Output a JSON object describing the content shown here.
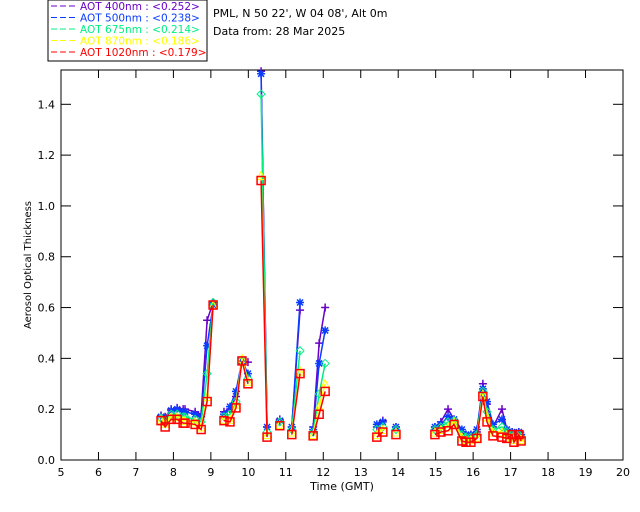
{
  "header": {
    "site": "PML, N 50 22', W 04 08', Alt 0m",
    "date": "Data from: 28 Mar 2025"
  },
  "chart_data": {
    "type": "line",
    "title": "",
    "xlabel": "Time (GMT)",
    "ylabel": "Aerosol Optical Thickness",
    "xlim": [
      5,
      20
    ],
    "ylim": [
      0,
      1.535
    ],
    "xticks": [
      "5",
      "6",
      "7",
      "8",
      "9",
      "10",
      "11",
      "12",
      "13",
      "14",
      "15",
      "16",
      "17",
      "18",
      "19",
      "20"
    ],
    "yticks": [
      "0.0",
      "0.2",
      "0.4",
      "0.6",
      "0.8",
      "1.0",
      "1.2",
      "1.4"
    ],
    "grid": false,
    "legend_position": "top-left",
    "segments": [
      [
        7.67,
        7.78,
        7.94,
        8.1,
        8.26,
        8.31,
        8.58,
        8.74,
        8.9,
        9.06
      ],
      [
        9.35,
        9.51,
        9.67,
        9.83,
        9.99
      ],
      [
        10.34,
        10.5
      ],
      [
        10.84
      ],
      [
        11.16,
        11.38
      ],
      [
        11.73,
        11.89,
        12.05
      ],
      [
        13.43,
        13.59
      ],
      [
        13.94
      ],
      [
        14.98,
        15.14,
        15.33,
        15.49,
        15.7,
        15.81,
        15.94,
        16.1,
        16.26,
        16.37,
        16.53,
        16.77,
        16.9,
        17.04,
        17.09,
        17.22,
        17.28
      ]
    ],
    "series": [
      {
        "name": "AOT  400nm : <0.252>",
        "color": "#6a00c8",
        "marker": "plus",
        "values": [
          [
            0.175,
            0.17,
            0.2,
            0.205,
            0.2,
            0.2,
            0.19,
            0.18,
            0.55,
            0.62
          ],
          [
            0.19,
            0.2,
            0.25,
            0.39,
            0.385
          ],
          [
            1.53,
            0.13
          ],
          [
            0.16
          ],
          [
            0.13,
            0.59
          ],
          [
            0.13,
            0.46,
            0.6
          ],
          [
            0.13,
            0.155
          ],
          [
            0.13
          ],
          [
            0.13,
            0.15,
            0.2,
            0.16,
            0.11,
            0.1,
            0.1,
            0.11,
            0.3,
            0.22,
            0.13,
            0.2,
            0.12,
            0.11,
            0.1,
            0.11,
            0.1
          ]
        ]
      },
      {
        "name": "AOT  500nm : <0.238>",
        "color": "#0a3cff",
        "marker": "asterisk",
        "values": [
          [
            0.17,
            0.165,
            0.195,
            0.2,
            0.19,
            0.19,
            0.18,
            0.17,
            0.45,
            0.61
          ],
          [
            0.18,
            0.21,
            0.27,
            0.39,
            0.34
          ],
          [
            1.52,
            0.13
          ],
          [
            0.155
          ],
          [
            0.13,
            0.62
          ],
          [
            0.12,
            0.38,
            0.51
          ],
          [
            0.14,
            0.15
          ],
          [
            0.13
          ],
          [
            0.13,
            0.14,
            0.17,
            0.16,
            0.12,
            0.1,
            0.1,
            0.12,
            0.28,
            0.23,
            0.14,
            0.16,
            0.12,
            0.11,
            0.1,
            0.11,
            0.1
          ]
        ]
      },
      {
        "name": "AOT  675nm : <0.214>",
        "color": "#00f080",
        "marker": "diamond",
        "values": [
          [
            0.165,
            0.155,
            0.18,
            0.18,
            0.17,
            0.17,
            0.16,
            0.15,
            0.34,
            0.62
          ],
          [
            0.17,
            0.18,
            0.23,
            0.39,
            0.32
          ],
          [
            1.44,
            0.11
          ],
          [
            0.15
          ],
          [
            0.12,
            0.43
          ],
          [
            0.11,
            0.26,
            0.38
          ],
          [
            0.12,
            0.13
          ],
          [
            0.12
          ],
          [
            0.12,
            0.13,
            0.15,
            0.155,
            0.1,
            0.09,
            0.09,
            0.1,
            0.27,
            0.19,
            0.12,
            0.13,
            0.11,
            0.1,
            0.09,
            0.1,
            0.09
          ]
        ]
      },
      {
        "name": "AOT  870nm : <0.186>",
        "color": "#ffff00",
        "marker": "triangle",
        "values": [
          [
            0.16,
            0.145,
            0.17,
            0.17,
            0.155,
            0.155,
            0.15,
            0.13,
            0.25,
            0.61
          ],
          [
            0.16,
            0.16,
            0.22,
            0.4,
            0.31
          ],
          [
            1.12,
            0.1
          ],
          [
            0.14
          ],
          [
            0.11,
            0.35
          ],
          [
            0.1,
            0.21,
            0.3
          ],
          [
            0.1,
            0.12
          ],
          [
            0.11
          ],
          [
            0.11,
            0.12,
            0.13,
            0.15,
            0.09,
            0.08,
            0.08,
            0.09,
            0.26,
            0.17,
            0.11,
            0.11,
            0.1,
            0.09,
            0.08,
            0.09,
            0.08
          ]
        ]
      },
      {
        "name": "AOT 1020nm : <0.179>",
        "color": "#ff0000",
        "marker": "square",
        "values": [
          [
            0.155,
            0.13,
            0.16,
            0.16,
            0.145,
            0.145,
            0.14,
            0.12,
            0.23,
            0.61
          ],
          [
            0.155,
            0.15,
            0.205,
            0.39,
            0.3
          ],
          [
            1.1,
            0.09
          ],
          [
            0.135
          ],
          [
            0.1,
            0.34
          ],
          [
            0.095,
            0.18,
            0.27
          ],
          [
            0.09,
            0.11
          ],
          [
            0.1
          ],
          [
            0.1,
            0.11,
            0.115,
            0.14,
            0.075,
            0.07,
            0.07,
            0.085,
            0.25,
            0.15,
            0.095,
            0.09,
            0.085,
            0.1,
            0.07,
            0.1,
            0.075
          ]
        ]
      }
    ]
  }
}
